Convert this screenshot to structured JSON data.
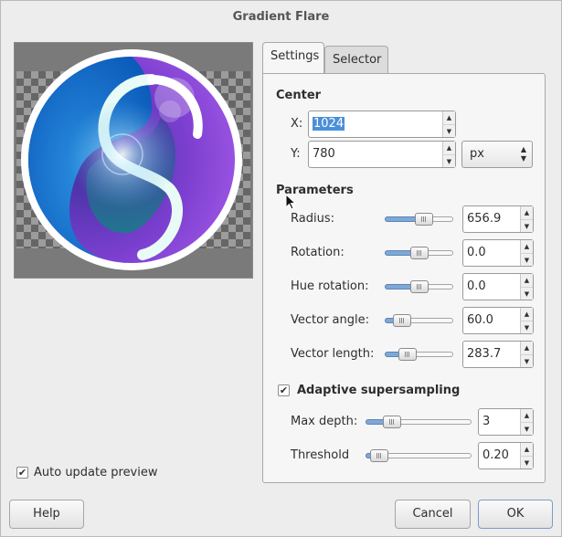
{
  "window": {
    "title": "Gradient Flare"
  },
  "tabs": [
    {
      "label": "Settings"
    },
    {
      "label": "Selector"
    }
  ],
  "center": {
    "heading": "Center",
    "x_label": "X:",
    "x_value": "1024",
    "y_label": "Y:",
    "y_value": "780",
    "unit": "px"
  },
  "parameters": {
    "heading": "Parameters",
    "rows": [
      {
        "label": "Radius:",
        "value": "656.9",
        "level": 0.6
      },
      {
        "label": "Rotation:",
        "value": "0.0",
        "level": 0.5
      },
      {
        "label": "Hue rotation:",
        "value": "0.0",
        "level": 0.5
      },
      {
        "label": "Vector angle:",
        "value": "60.0",
        "level": 0.17
      },
      {
        "label": "Vector length:",
        "value": "283.7",
        "level": 0.28
      }
    ]
  },
  "supersampling": {
    "label": "Adaptive supersampling",
    "checked": true,
    "rows": [
      {
        "label": "Max depth:",
        "value": "3",
        "level": 0.2
      },
      {
        "label": "Threshold",
        "value": "0.20",
        "level": 0.05
      }
    ]
  },
  "auto_update": {
    "label": "Auto update preview",
    "checked": true
  },
  "buttons": {
    "help": "Help",
    "cancel": "Cancel",
    "ok": "OK"
  },
  "colors": {
    "accent": "#4a90d9",
    "slider_fill": "#7fa8d8"
  }
}
